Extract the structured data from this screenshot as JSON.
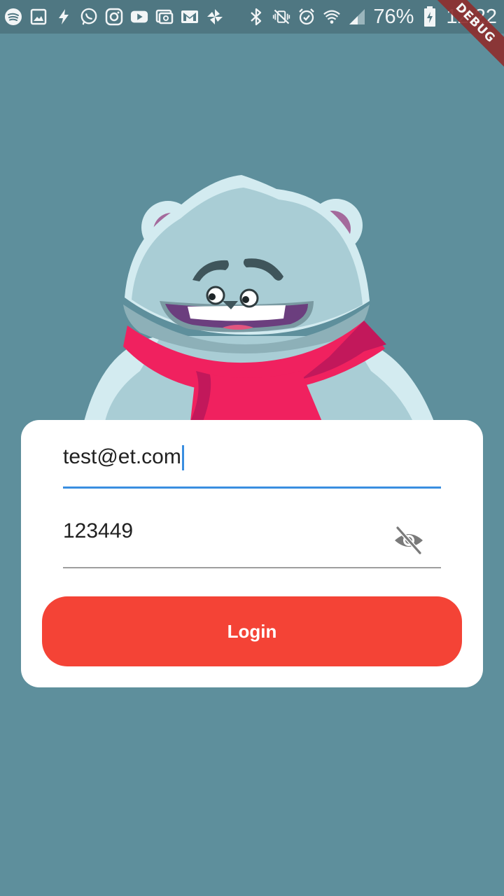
{
  "status_bar": {
    "battery_percent": "76%",
    "time": "12:22",
    "left_icons": [
      "spotify-icon",
      "gallery-icon",
      "flash-icon",
      "whatsapp-icon",
      "instagram-icon",
      "youtube-icon",
      "cast-icon",
      "gmail-icon",
      "pinwheel-icon"
    ],
    "right_icons": [
      "bluetooth-icon",
      "vibrate-icon",
      "alarm-icon",
      "wifi-icon",
      "signal-icon",
      "battery-icon"
    ]
  },
  "debug_banner": {
    "label": "DEBUG"
  },
  "login_form": {
    "email_value": "test@et.com",
    "password_value": "123449",
    "password_toggle_icon": "eye-off-icon",
    "login_label": "Login"
  },
  "colors": {
    "background": "#5e8f9c",
    "status_bar": "#4f7782",
    "card": "#ffffff",
    "accent": "#3a8ee0",
    "button": "#f44336"
  }
}
